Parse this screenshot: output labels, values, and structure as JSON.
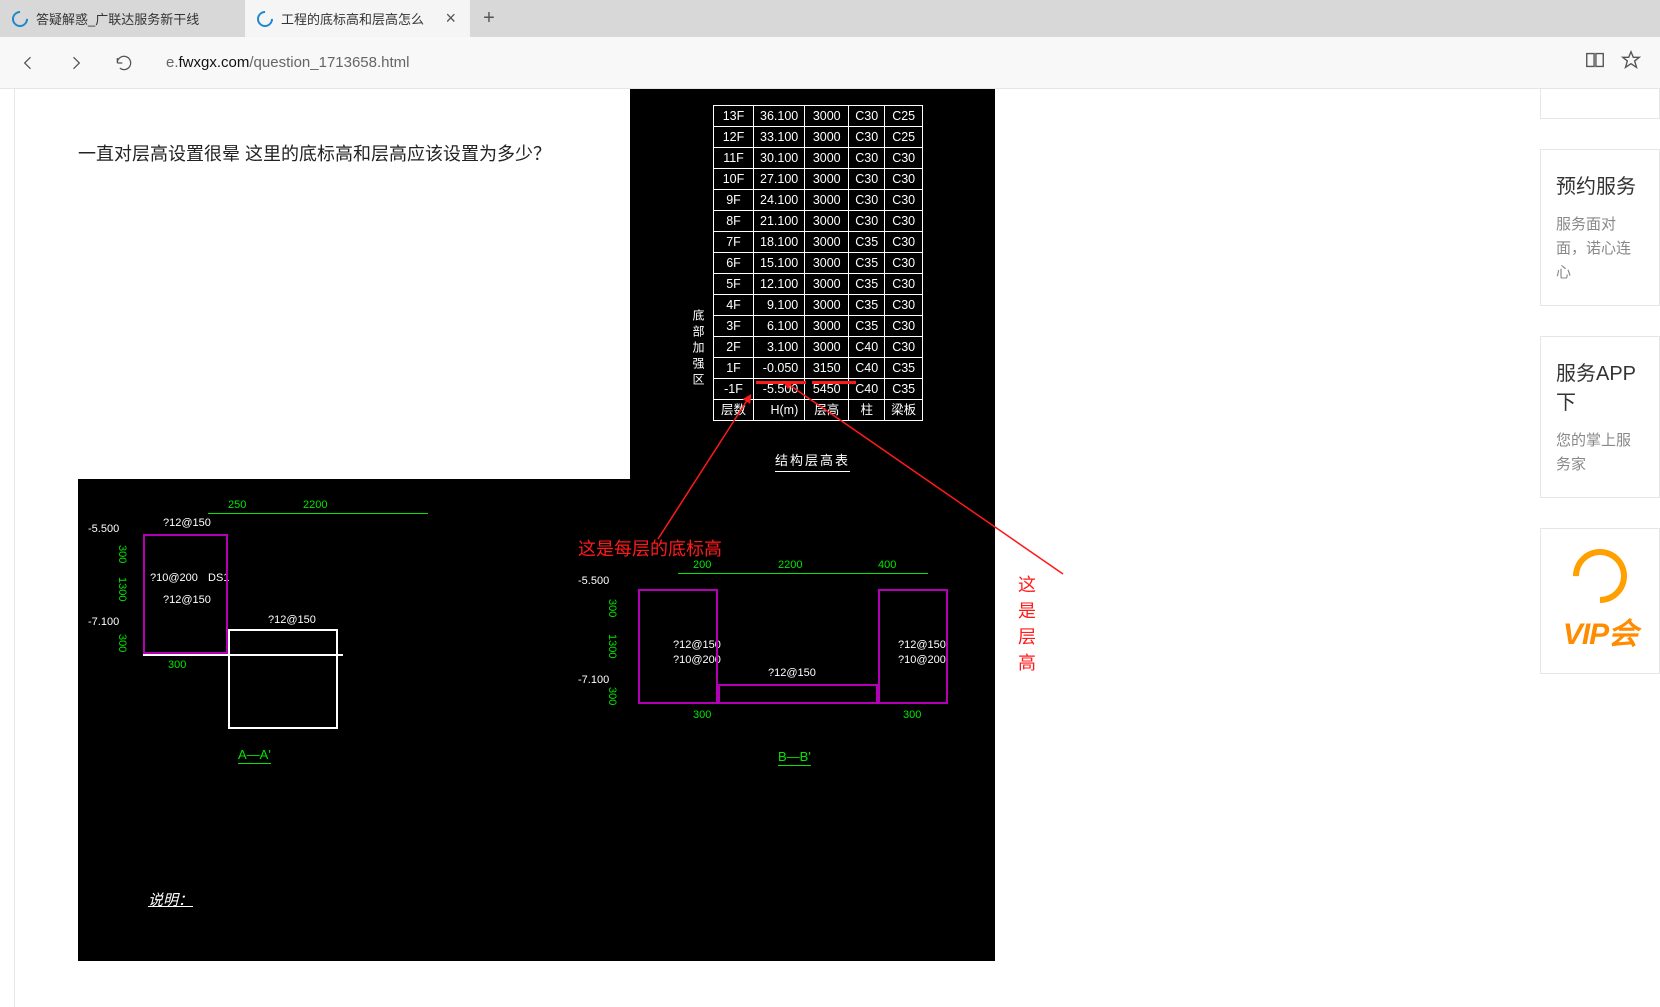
{
  "browser": {
    "tabs": [
      {
        "title": "答疑解惑_广联达服务新干线"
      },
      {
        "title": "工程的底标高和层高怎么"
      }
    ],
    "url_prefix": "e.",
    "url_domain": "fwxgx.com",
    "url_path": "/question_1713658.html"
  },
  "question": {
    "title": "一直对层高设置很晕 这里的底标高和层高应该设置为多少？"
  },
  "floor_table": {
    "rows": [
      [
        "13F",
        "36.100",
        "3000",
        "C30",
        "C25"
      ],
      [
        "12F",
        "33.100",
        "3000",
        "C30",
        "C25"
      ],
      [
        "11F",
        "30.100",
        "3000",
        "C30",
        "C30"
      ],
      [
        "10F",
        "27.100",
        "3000",
        "C30",
        "C30"
      ],
      [
        "9F",
        "24.100",
        "3000",
        "C30",
        "C30"
      ],
      [
        "8F",
        "21.100",
        "3000",
        "C30",
        "C30"
      ],
      [
        "7F",
        "18.100",
        "3000",
        "C35",
        "C30"
      ],
      [
        "6F",
        "15.100",
        "3000",
        "C35",
        "C30"
      ],
      [
        "5F",
        "12.100",
        "3000",
        "C35",
        "C30"
      ],
      [
        "4F",
        "9.100",
        "3000",
        "C35",
        "C30"
      ],
      [
        "3F",
        "6.100",
        "3000",
        "C35",
        "C30"
      ],
      [
        "2F",
        "3.100",
        "3000",
        "C40",
        "C30"
      ],
      [
        "1F",
        "-0.050",
        "3150",
        "C40",
        "C35"
      ],
      [
        "-1F",
        "-5.500",
        "5450",
        "C40",
        "C35"
      ],
      [
        "层数",
        "H(m)",
        "层高",
        "柱",
        "梁板"
      ]
    ],
    "table_title": "结构层高表",
    "side_label": "底部加强区"
  },
  "annotations": {
    "left": "这是每层的底标高",
    "right": "这是层高"
  },
  "sections": {
    "a": {
      "title": "A—A'",
      "top_dims": [
        "250",
        "2200"
      ],
      "left_levels_top": "-5.500",
      "left_levels_bot": "-7.100",
      "v_dims_left": [
        "300",
        "1300",
        "300"
      ],
      "rebar1": "?12@150",
      "rebar2": "?10@200",
      "rebar3": "?12@150",
      "rebar4": "?12@150",
      "tag1": "DS1",
      "bot_dim": "300",
      "note": "说明："
    },
    "b": {
      "title": "B—B'",
      "top_dims": [
        "200",
        "2200",
        "400"
      ],
      "left_levels_top": "-5.500",
      "left_levels_bot": "-7.100",
      "v_dims_left": [
        "300",
        "1300",
        "300"
      ],
      "rebar1": "?12@150",
      "rebar2": "?10@200",
      "rebar3": "?12@150",
      "rebar4": "?12@150",
      "rebar5": "?10@200",
      "bot_dim1": "300",
      "bot_dim2": "300"
    }
  },
  "sidebar": {
    "card1": {
      "title": "预约服务",
      "desc": "服务面对面，诺心连心"
    },
    "card2": {
      "title": "服务APP下",
      "desc": "您的掌上服务家"
    },
    "vip": "VIP会"
  }
}
